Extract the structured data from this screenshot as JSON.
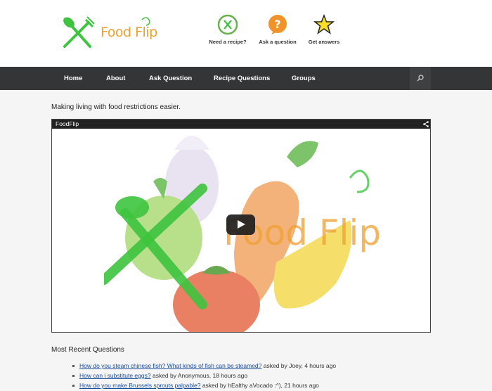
{
  "logo": {
    "text": "Food Flip"
  },
  "header_links": [
    {
      "label": "Need a recipe?",
      "icon": "fork-knife-icon",
      "color": "#6ab04c"
    },
    {
      "label": "Ask a question",
      "icon": "question-icon",
      "color": "#f0932b"
    },
    {
      "label": "Get answers",
      "icon": "star-icon",
      "color": "#f9ca24"
    }
  ],
  "nav": {
    "items": [
      "Home",
      "About",
      "Ask Question",
      "Recipe Questions",
      "Groups"
    ],
    "search_icon": "search-icon"
  },
  "tagline": "Making living with food restrictions easier.",
  "video": {
    "title": "FoodFlip",
    "overlay_text": "Food Flip",
    "share_icon": "share-icon",
    "play_icon": "play-icon"
  },
  "recent": {
    "heading": "Most Recent Questions",
    "items": [
      {
        "question": "How do you steam chinese fish? What kinds of fish can be steamed?",
        "meta": "asked by Joey, 4 hours ago"
      },
      {
        "question": "How can i substitute eggs?",
        "meta": "asked by Anonymous, 18 hours ago"
      },
      {
        "question": "How do you make Brussels sprouts palpable?",
        "meta": "asked by hEalthy aVocado :^), 21 hours ago"
      }
    ]
  },
  "colors": {
    "nav_bg": "#333537",
    "brand_green": "#3ec43e",
    "brand_orange": "#f0a030",
    "link": "#1a4c9c"
  }
}
